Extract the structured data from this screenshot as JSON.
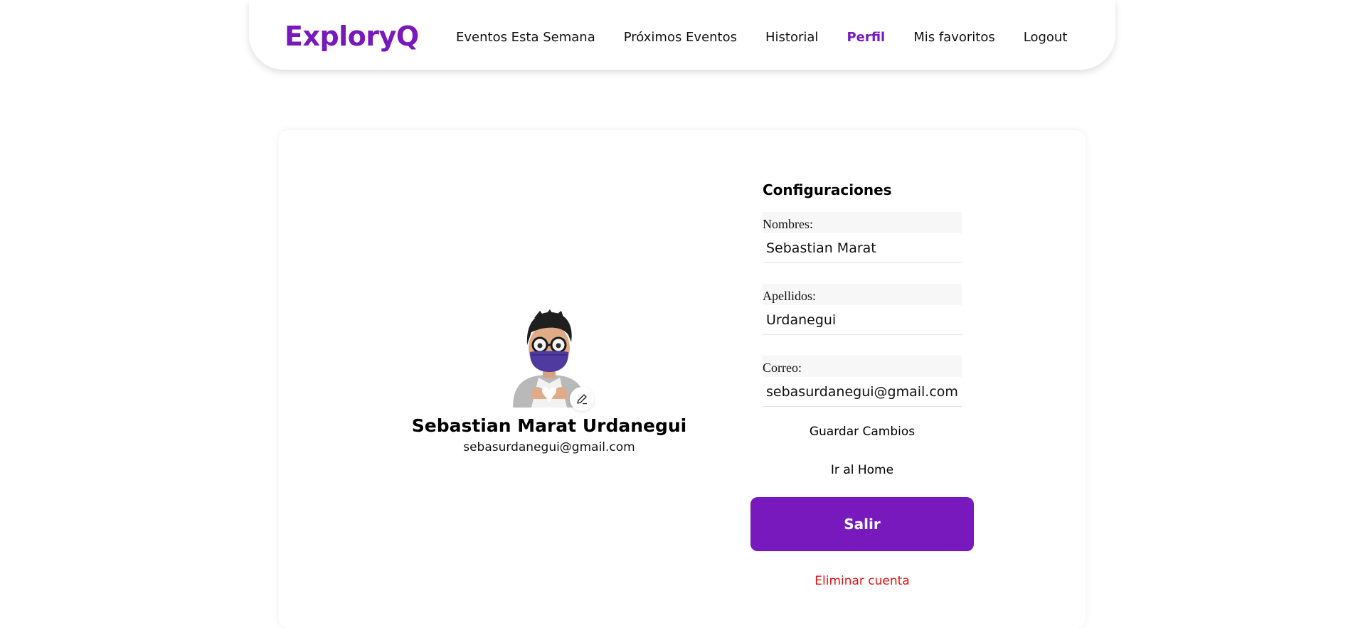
{
  "brand": {
    "name": "ExploryQ",
    "accent_color": "#7719bd"
  },
  "nav": {
    "items": [
      {
        "label": "Eventos Esta Semana",
        "active": false
      },
      {
        "label": "Próximos Eventos",
        "active": false
      },
      {
        "label": "Historial",
        "active": false
      },
      {
        "label": "Perfil",
        "active": true
      },
      {
        "label": "Mis favoritos",
        "active": false
      },
      {
        "label": "Logout",
        "active": false
      }
    ]
  },
  "profile": {
    "full_name": "Sebastian Marat Urdanegui",
    "email": "sebasurdanegui@gmail.com",
    "avatar_icon": "memoji-avatar",
    "edit_icon": "pencil-icon"
  },
  "settings": {
    "title": "Configuraciones",
    "nombres_label": "Nombres:",
    "nombres_value": "Sebastian Marat",
    "apellidos_label": "Apellidos:",
    "apellidos_value": "Urdanegui",
    "correo_label": "Correo:",
    "correo_value": "sebasurdanegui@gmail.com",
    "save_label": "Guardar Cambios",
    "home_label": "Ir al Home",
    "logout_label": "Salir",
    "delete_label": "Eliminar cuenta",
    "delete_color": "#e31313"
  }
}
